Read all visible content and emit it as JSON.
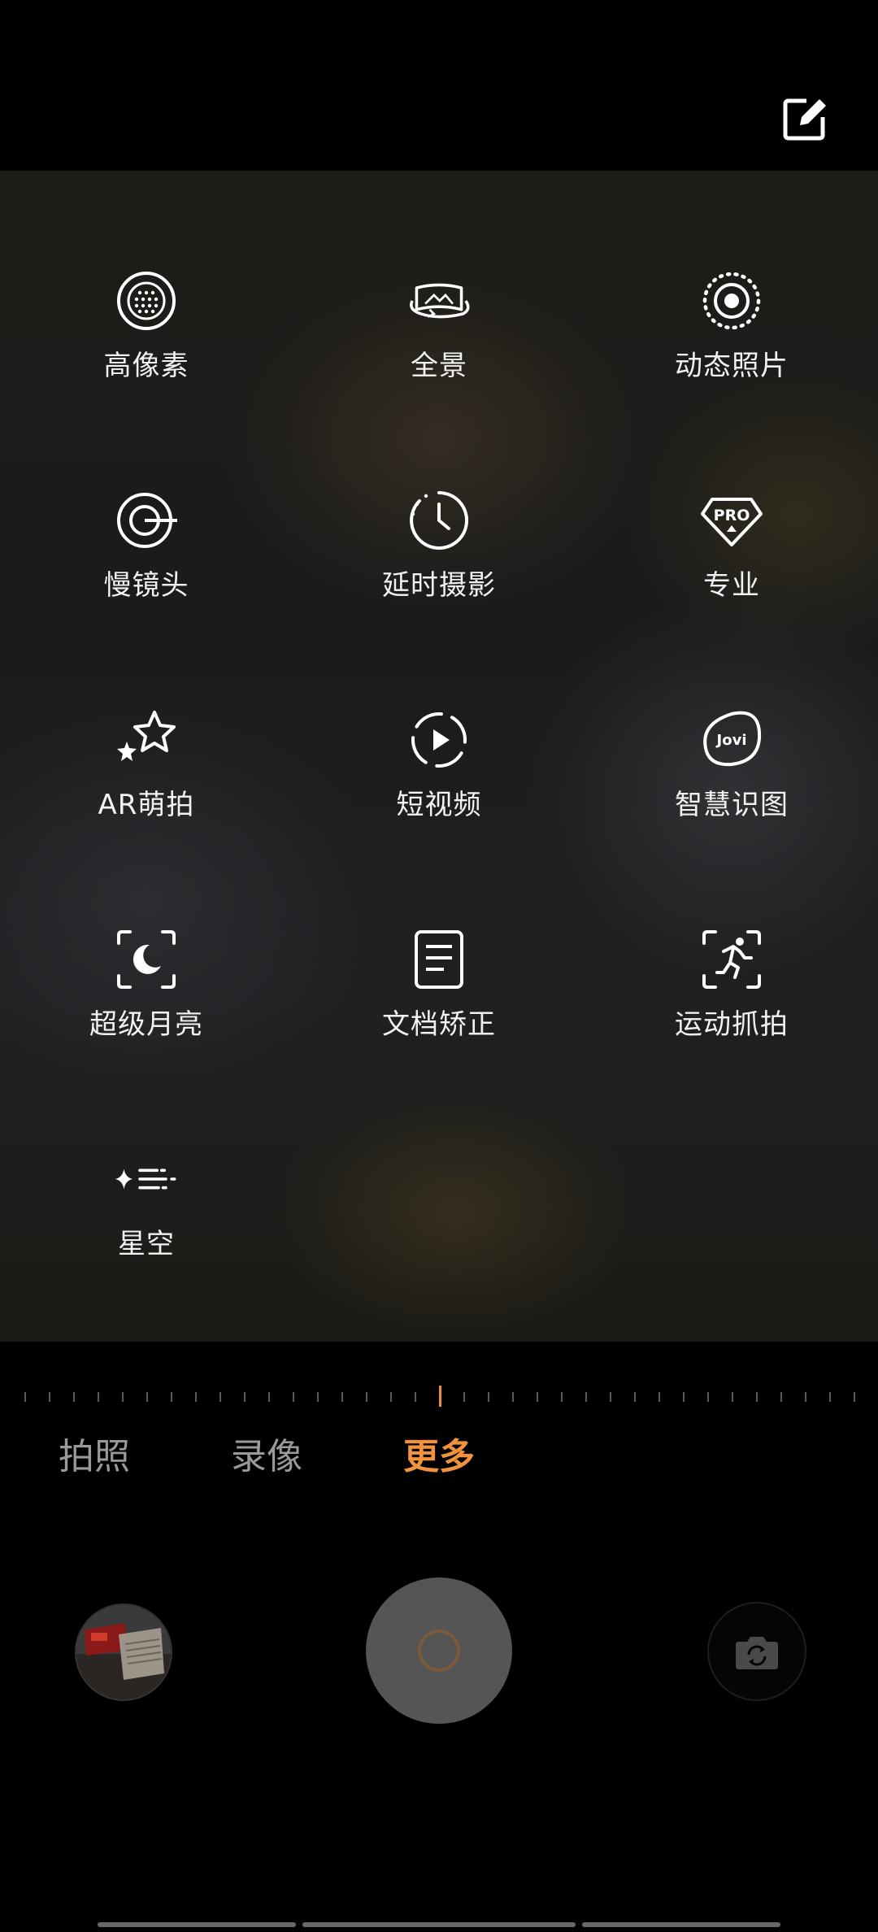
{
  "top": {
    "edit_icon": "edit-icon"
  },
  "modes": [
    {
      "label": "高像素",
      "icon": "high-pixel-icon"
    },
    {
      "label": "全景",
      "icon": "panorama-icon"
    },
    {
      "label": "动态照片",
      "icon": "live-photo-icon"
    },
    {
      "label": "慢镜头",
      "icon": "slow-motion-icon"
    },
    {
      "label": "延时摄影",
      "icon": "time-lapse-icon"
    },
    {
      "label": "专业",
      "icon": "pro-icon"
    },
    {
      "label": "AR萌拍",
      "icon": "ar-stars-icon"
    },
    {
      "label": "短视频",
      "icon": "short-video-icon"
    },
    {
      "label": "智慧识图",
      "icon": "jovi-icon"
    },
    {
      "label": "超级月亮",
      "icon": "super-moon-icon"
    },
    {
      "label": "文档矫正",
      "icon": "document-icon"
    },
    {
      "label": "运动抓拍",
      "icon": "sport-snap-icon"
    },
    {
      "label": "星空",
      "icon": "starry-sky-icon"
    }
  ],
  "tabs": [
    {
      "label": "拍照",
      "active": false
    },
    {
      "label": "录像",
      "active": false
    },
    {
      "label": "更多",
      "active": true
    }
  ],
  "colors": {
    "accent": "#f0933c",
    "text": "#f2f2f2",
    "inactive_tab": "#9a9a9a"
  },
  "bottom": {
    "gallery_icon": "gallery-thumbnail",
    "shutter_icon": "shutter-button",
    "switch_icon": "camera-switch-icon"
  },
  "jovi_text": "Jovi",
  "pro_text": "PRO"
}
